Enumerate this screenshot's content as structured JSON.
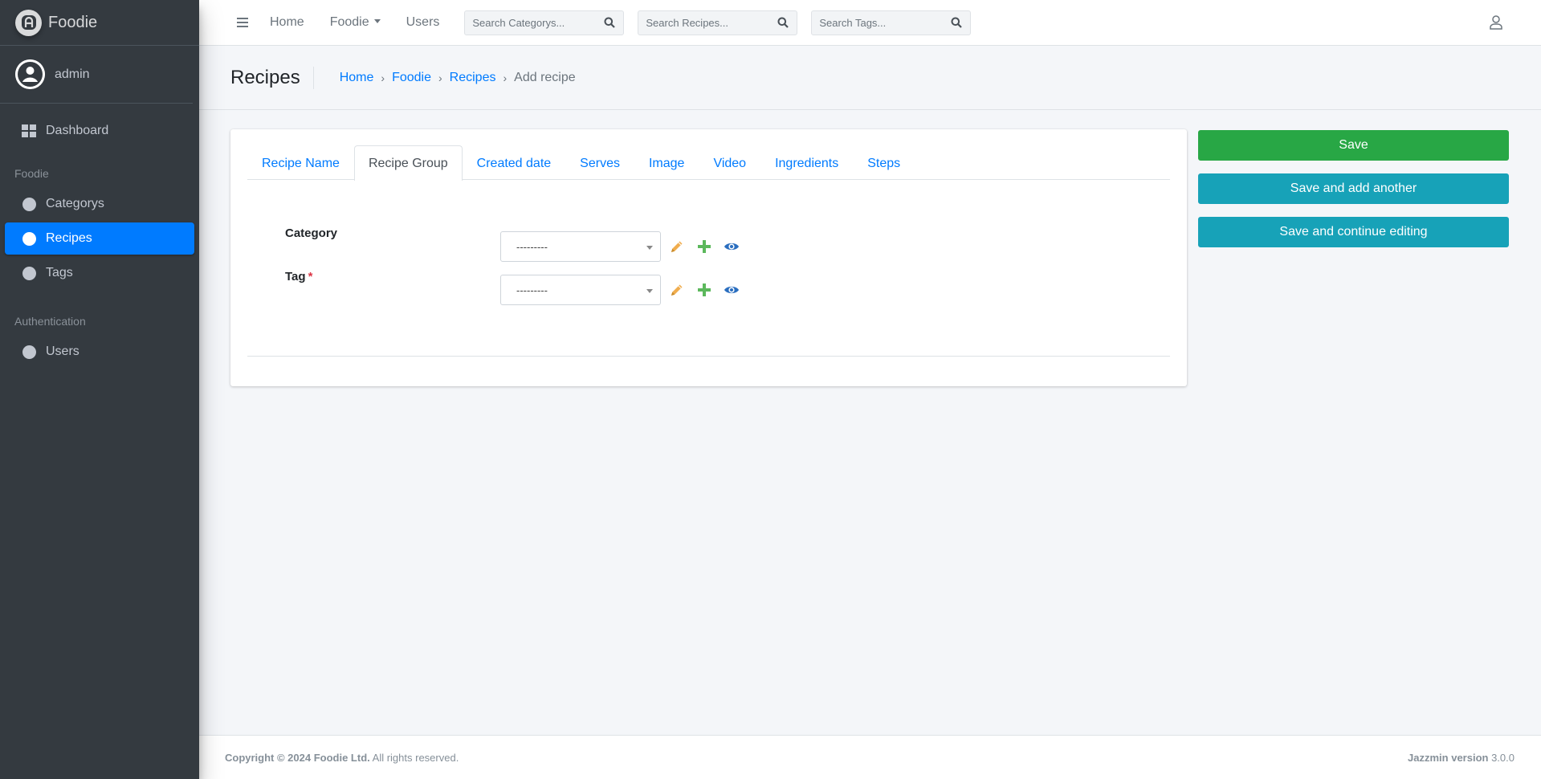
{
  "brand": {
    "name": "Foodie",
    "logo_icon": "jazzmin-logo-icon"
  },
  "user": {
    "name": "admin"
  },
  "sidebar": {
    "dashboard_label": "Dashboard",
    "sections": [
      {
        "header": "Foodie",
        "items": [
          {
            "label": "Categorys"
          },
          {
            "label": "Recipes",
            "active": true
          },
          {
            "label": "Tags"
          }
        ]
      },
      {
        "header": "Authentication",
        "items": [
          {
            "label": "Users"
          }
        ]
      }
    ]
  },
  "topbar": {
    "links": {
      "home": "Home",
      "foodie": "Foodie",
      "users": "Users"
    },
    "search_categorys": {
      "placeholder": "Search Categorys..."
    },
    "search_recipes": {
      "placeholder": "Search Recipes..."
    },
    "search_tags": {
      "placeholder": "Search Tags..."
    }
  },
  "header": {
    "title": "Recipes",
    "breadcrumb": {
      "home": "Home",
      "foodie": "Foodie",
      "recipes": "Recipes",
      "current": "Add recipe",
      "separator": "›"
    }
  },
  "tabs": [
    {
      "label": "Recipe Name"
    },
    {
      "label": "Recipe Group",
      "active": true
    },
    {
      "label": "Created date"
    },
    {
      "label": "Serves"
    },
    {
      "label": "Image"
    },
    {
      "label": "Video"
    },
    {
      "label": "Ingredients"
    },
    {
      "label": "Steps"
    }
  ],
  "form": {
    "category": {
      "label": "Category",
      "value": "---------"
    },
    "tag": {
      "label": "Tag",
      "required_mark": "*",
      "value": "---------"
    }
  },
  "buttons": {
    "save": "Save",
    "save_add_another": "Save and add another",
    "save_continue": "Save and continue editing"
  },
  "footer": {
    "copyright_bold": "Copyright © 2024 Foodie Ltd.",
    "copyright_rest": " All rights reserved.",
    "version_label": "Jazzmin version",
    "version_value": " 3.0.0"
  },
  "colors": {
    "sidebar_bg": "#343a40",
    "primary": "#007bff",
    "success": "#28a745",
    "info": "#17a2b8",
    "edit_icon": "#f0ad4e",
    "add_icon": "#5cb85c",
    "view_icon": "#2a6ebf"
  }
}
